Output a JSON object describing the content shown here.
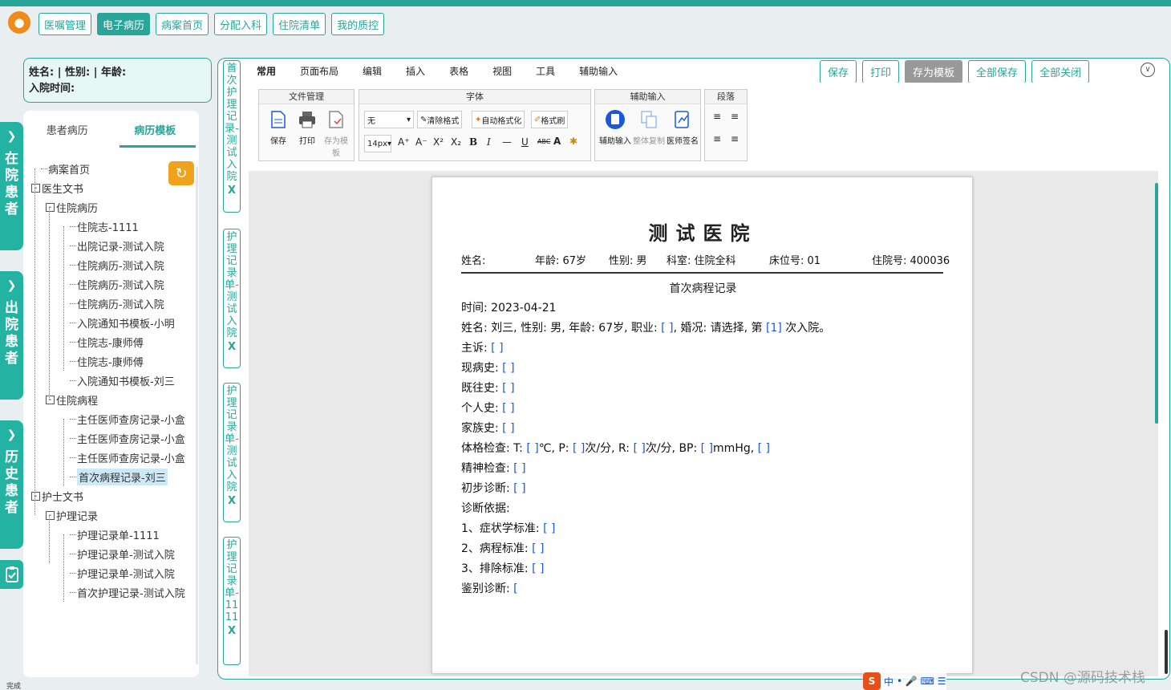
{
  "colors": {
    "accent": "#2aa59a",
    "sidebar": "#24b3a3",
    "logo": "#f08a1a",
    "field": "#1a5ad8"
  },
  "top_nav": [
    "医嘱管理",
    "电子病历",
    "病案首页",
    "分配入科",
    "住院清单",
    "我的质控"
  ],
  "top_nav_active": "电子病历",
  "sidebar": [
    {
      "label": "在院患者",
      "icon": "chevron-right-icon"
    },
    {
      "label": "出院患者",
      "icon": "chevron-right-icon"
    },
    {
      "label": "历史患者",
      "icon": "chevron-right-icon"
    }
  ],
  "patient_info": {
    "line1": "姓名:  | 性别:  | 年龄:",
    "line2": "入院时间:"
  },
  "tree_tabs": [
    "患者病历",
    "病历模板"
  ],
  "tree_active": "病历模板",
  "tree": [
    {
      "label": "病案首页",
      "level": 0,
      "box": ""
    },
    {
      "label": "医生文书",
      "level": 0,
      "box": "-"
    },
    {
      "label": "住院病历",
      "level": 1,
      "box": "-"
    },
    {
      "label": "住院志-1111",
      "level": 2,
      "box": ""
    },
    {
      "label": "出院记录-测试入院",
      "level": 2,
      "box": ""
    },
    {
      "label": "住院病历-测试入院",
      "level": 2,
      "box": ""
    },
    {
      "label": "住院病历-测试入院",
      "level": 2,
      "box": ""
    },
    {
      "label": "住院病历-测试入院",
      "level": 2,
      "box": ""
    },
    {
      "label": "入院通知书模板-小明",
      "level": 2,
      "box": ""
    },
    {
      "label": "住院志-康师傅",
      "level": 2,
      "box": ""
    },
    {
      "label": "住院志-康师傅",
      "level": 2,
      "box": ""
    },
    {
      "label": "入院通知书模板-刘三",
      "level": 2,
      "box": ""
    },
    {
      "label": "住院病程",
      "level": 1,
      "box": "-"
    },
    {
      "label": "主任医师查房记录-小盒",
      "level": 2,
      "box": ""
    },
    {
      "label": "主任医师查房记录-小盒",
      "level": 2,
      "box": ""
    },
    {
      "label": "主任医师查房记录-小盒",
      "level": 2,
      "box": ""
    },
    {
      "label": "首次病程记录-刘三",
      "level": 2,
      "box": "",
      "selected": true
    },
    {
      "label": "护士文书",
      "level": 0,
      "box": "-"
    },
    {
      "label": "护理记录",
      "level": 1,
      "box": "-"
    },
    {
      "label": "护理记录单-1111",
      "level": 2,
      "box": ""
    },
    {
      "label": "护理记录单-测试入院",
      "level": 2,
      "box": ""
    },
    {
      "label": "护理记录单-测试入院",
      "level": 2,
      "box": ""
    },
    {
      "label": "首次护理记录-测试入院",
      "level": 2,
      "box": ""
    }
  ],
  "vertical_tabs": [
    "首次护理记录-测试入院",
    "护理记录单-测试入院",
    "护理记录单-测试入院",
    "护理记录单-1111"
  ],
  "vertical_close": "X",
  "ribbon_tabs": [
    "常用",
    "页面布局",
    "编辑",
    "插入",
    "表格",
    "视图",
    "工具",
    "辅助输入"
  ],
  "action_buttons": [
    "保存",
    "打印",
    "存为模板",
    "全部保存",
    "全部关闭"
  ],
  "groups": {
    "file": {
      "title": "文件管理",
      "buttons": [
        "保存",
        "打印",
        "存为模板"
      ]
    },
    "font": {
      "title": "字体",
      "font_value": "无",
      "size_value": "14px",
      "buttons": [
        "清除格式",
        "自动格式化",
        "格式刷"
      ],
      "format_glyphs": [
        "A⁺",
        "A⁻",
        "X²",
        "X₂",
        "B",
        "I",
        "—",
        "U",
        "ABC",
        "A",
        "✱"
      ]
    },
    "assist": {
      "title": "辅助输入",
      "buttons": [
        "辅助输入",
        "整体复制",
        "医师签名"
      ]
    },
    "para": {
      "title": "段落"
    }
  },
  "document": {
    "hospital": "测试医院",
    "header": {
      "name": "姓名:",
      "age": "年龄: 67岁",
      "sex": "性别: 男",
      "dept": "科室: 住院全科",
      "bed": "床位号: 01",
      "inpatient": "住院号: 400036"
    },
    "subtitle": "首次病程记录",
    "lines": [
      {
        "t": "时间:  2023-04-21",
        "f": ""
      },
      {
        "t": "姓名:  刘三,  性别:  男,  年龄:  67岁,  职业:",
        "f": " [ ]",
        "t2": ",  婚况:  请选择,  第",
        "f2": "  [1]",
        "t3": "  次入院。"
      },
      {
        "t": "主诉:",
        "f": " [ ]"
      },
      {
        "t": "现病史:",
        "f": " [ ]"
      },
      {
        "t": "既往史:",
        "f": " [ ]"
      },
      {
        "t": "个人史:",
        "f": " [ ]"
      },
      {
        "t": "家族史:",
        "f": " [ ]"
      },
      {
        "t": "体格检查:  T:",
        "f": " [ ]",
        "t2": "℃,  P:",
        "f2": " [ ]",
        "t3": "次/分,  R:",
        "f3": " [ ]",
        "t4": "次/分,  BP:",
        "f4": " [ ]",
        "t5": "mmHg,",
        "f5": " [ ]"
      },
      {
        "t": "精神检查:",
        "f": " [ ]"
      },
      {
        "t": "初步诊断:",
        "f": " [ ]"
      },
      {
        "t": "诊断依据:",
        "f": ""
      },
      {
        "t": "      1、症状学标准:",
        "f": " [ ]"
      },
      {
        "t": "      2、病程标准:",
        "f": " [ ]"
      },
      {
        "t": "      3、排除标准:",
        "f": " [ ]"
      },
      {
        "t": "鉴别诊断:",
        "f": " ["
      }
    ]
  },
  "status_text": "完成",
  "ime": {
    "logo": "S",
    "lang": "中"
  },
  "watermark": "CSDN @源码技术栈"
}
